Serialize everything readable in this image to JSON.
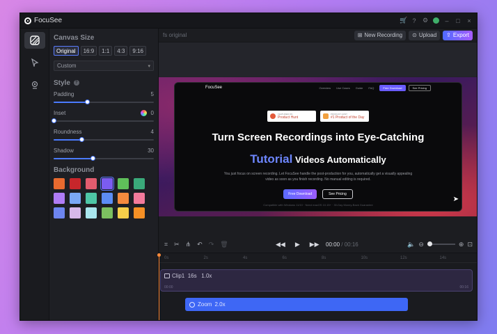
{
  "app": {
    "title": "FocuSee"
  },
  "titlebar": {
    "icons": [
      "cart-icon",
      "help-icon",
      "gear-icon",
      "avatar",
      "minimize-icon",
      "maximize-icon",
      "close-icon"
    ]
  },
  "leftbar": {
    "items": [
      "background-tool-icon",
      "cursor-tool-icon",
      "camera-tool-icon"
    ]
  },
  "panel": {
    "canvas_title": "Canvas Size",
    "ratios": [
      "Original",
      "16:9",
      "1:1",
      "4:3",
      "9:16"
    ],
    "selected_ratio": "Original",
    "custom_select": "Custom",
    "style_title": "Style",
    "padding": {
      "label": "Padding",
      "value": "5",
      "level": 0.33
    },
    "inset": {
      "label": "Inset",
      "value": "0",
      "level": 0.0
    },
    "roundness": {
      "label": "Roundness",
      "value": "4",
      "level": 0.28
    },
    "shadow": {
      "label": "Shadow",
      "value": "30",
      "level": 0.39
    },
    "background_title": "Background",
    "swatches": [
      "#e86a2f",
      "#c7262b",
      "#e35c6e",
      "#7b5cf0",
      "#5fbf5a",
      "#3aa97a",
      "#b07cf5",
      "#7aa8f5",
      "#4ec7a7",
      "#5c8df5",
      "#f58a3e",
      "#f37a9b",
      "#6d85f0",
      "#d7b9ea",
      "#a9e6ee",
      "#7cc060",
      "#f7cf4a",
      "#f69025"
    ],
    "selected_swatch": 3
  },
  "toolbar": {
    "filename": "fs original",
    "new_recording": "New Recording",
    "upload": "Upload",
    "export": "Export"
  },
  "preview": {
    "brand": "FocuSee",
    "nav_links": [
      "Overview",
      "Use Cases",
      "Guide",
      "FAQ"
    ],
    "nav_btn1": "Free Download",
    "nav_btn2": "See Pricing",
    "badge1_small": "FEATURED ON",
    "badge1": "Product Hunt",
    "badge2_small": "PRODUCT HUNT",
    "badge2": "#1 Product of the Day",
    "heading1": "Turn Screen Recordings into Eye-Catching",
    "heading2_accent": "Tutorial",
    "heading2_rest": " Videos Automatically",
    "sub": "You just focus on screen recording. Let FocuSee handle the post-production for you, automatically get a visually appealing video as soon as you finish recording. No manual editing is required.",
    "cta1": "Free Download",
    "cta2": "See Pricing",
    "footnote": "Compatible with Windows 11/10 · Need macOS 10.15+ · 30-Day Money-Back Guarantee"
  },
  "controls": {
    "time_current": "00:00",
    "time_total": "00:16"
  },
  "timeline": {
    "ticks": [
      "0s",
      "2s",
      "4s",
      "6s",
      "8s",
      "10s",
      "12s",
      "14s",
      "16s"
    ],
    "clip": {
      "label": "Clip1",
      "duration": "16s",
      "speed": "1.0x",
      "start": "00:00",
      "end": "00:16"
    },
    "zoom": {
      "label": "Zoom",
      "value": "2.0x"
    }
  }
}
